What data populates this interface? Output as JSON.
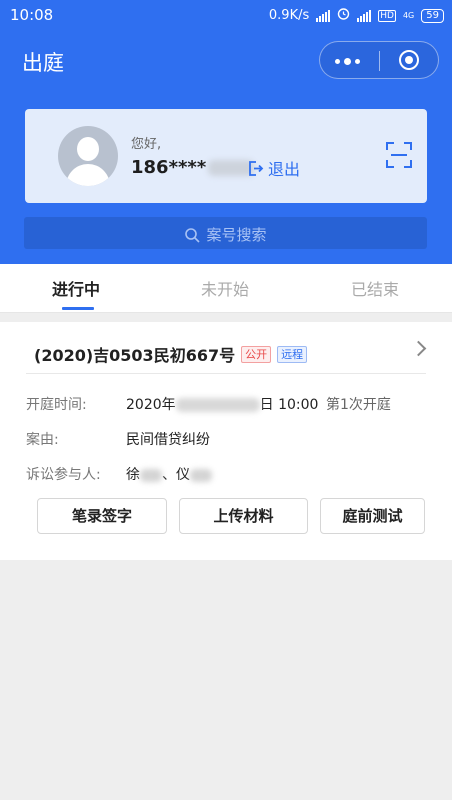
{
  "status_bar": {
    "time": "10:08",
    "network_speed": "0.9K/s",
    "hd": "HD",
    "network_type": "4G",
    "battery": "59"
  },
  "nav": {
    "title": "出庭",
    "more_icon": "more-dots-icon",
    "close_icon": "target-close-icon"
  },
  "user": {
    "greeting": "您好,",
    "phone_prefix": "186****",
    "logout_label": "退出",
    "avatar_icon": "person-avatar-icon",
    "scan_icon": "scan-icon"
  },
  "search": {
    "placeholder": "案号搜索"
  },
  "tabs": [
    {
      "label": "进行中",
      "active": true
    },
    {
      "label": "未开始",
      "active": false
    },
    {
      "label": "已结束",
      "active": false
    }
  ],
  "case": {
    "title": "(2020)吉0503民初667号",
    "badges": [
      {
        "label": "公开",
        "color": "#e84a4a"
      },
      {
        "label": "远程",
        "color": "#2f6ff0"
      }
    ],
    "hearing_time_label": "开庭时间:",
    "hearing_time_prefix": "2020年",
    "hearing_time_suffix": "日 10:00",
    "session_label": "第1次开庭",
    "cause_label": "案由:",
    "cause_value": "民间借贷纠纷",
    "parties_label": "诉讼参与人:",
    "party1_prefix": "徐",
    "party_sep": "、",
    "party2_prefix": "仪",
    "actions": [
      {
        "label": "笔录签字"
      },
      {
        "label": "上传材料"
      },
      {
        "label": "庭前测试"
      }
    ]
  },
  "colors": {
    "primary": "#2f6ff0",
    "search_bg": "#2862d5",
    "card_bg": "#e3ecfb"
  }
}
